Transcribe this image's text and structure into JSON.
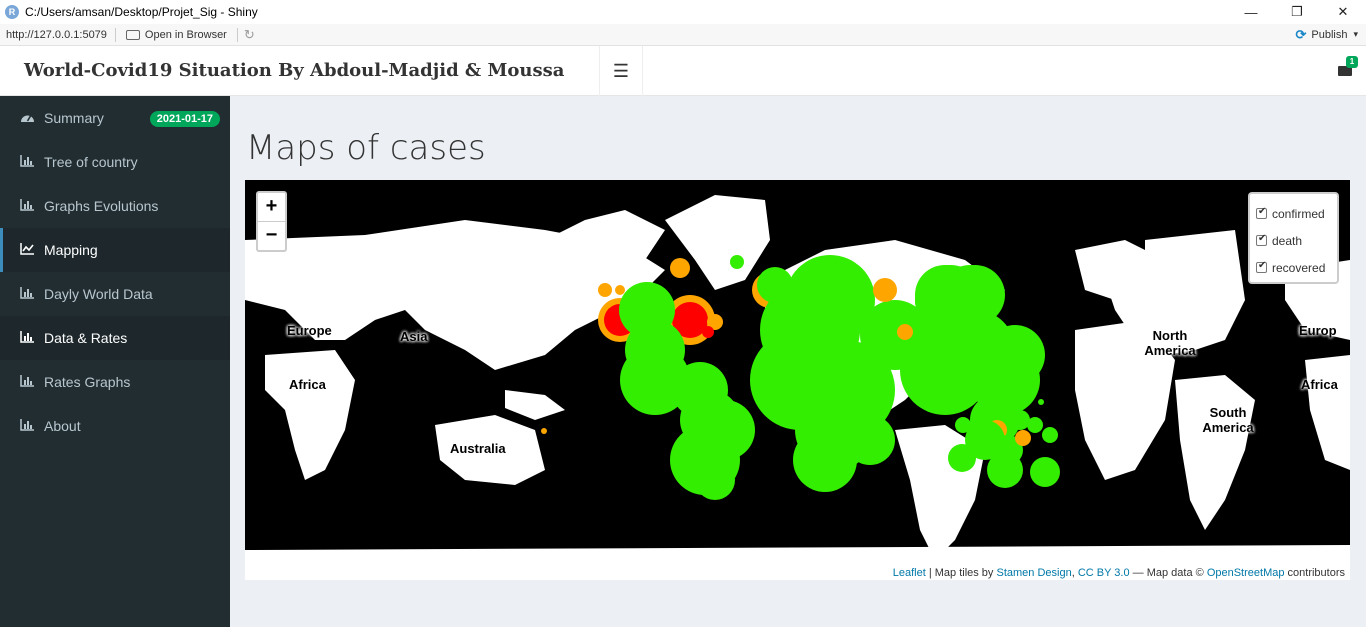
{
  "window": {
    "title": "C:/Users/amsan/Desktop/Projet_Sig - Shiny",
    "app_icon": "R",
    "minimize": "—",
    "maximize": "❐",
    "close": "✕"
  },
  "toolbar": {
    "url": "http://127.0.0.1:5079",
    "open_browser": "Open in Browser",
    "publish": "Publish",
    "publish_caret": "▾"
  },
  "header": {
    "brand": "World-Covid19 Situation By Abdoul-Madjid & Moussa",
    "menu_icon": "☰",
    "notifications_count": "1"
  },
  "sidebar": {
    "items": [
      {
        "label": "Summary",
        "icon": "dashboard-icon",
        "badge": "2021-01-17"
      },
      {
        "label": "Tree of country",
        "icon": "bar-chart-icon"
      },
      {
        "label": "Graphs Evolutions",
        "icon": "bar-chart-icon"
      },
      {
        "label": "Mapping",
        "icon": "line-chart-icon",
        "active": true
      },
      {
        "label": "Dayly World Data",
        "icon": "bar-chart-icon"
      },
      {
        "label": "Data & Rates",
        "icon": "bar-chart-icon"
      },
      {
        "label": "Rates Graphs",
        "icon": "bar-chart-icon"
      },
      {
        "label": "About",
        "icon": "bar-chart-icon"
      }
    ]
  },
  "main": {
    "title": "Maps of cases",
    "map": {
      "zoom_in": "+",
      "zoom_out": "−",
      "layers": [
        {
          "label": "confirmed",
          "checked": true
        },
        {
          "label": "death",
          "checked": true
        },
        {
          "label": "recovered",
          "checked": true
        }
      ],
      "labels": {
        "europe_left": "Europe",
        "asia": "Asia",
        "africa_left": "Africa",
        "australia": "Australia",
        "north_america": "North America",
        "europe_right": "Europ",
        "africa_right": "Africa",
        "south_america": "South America"
      },
      "attribution": {
        "leaflet": "Leaflet",
        "tiles_text": " | Map tiles by ",
        "stamen": "Stamen Design",
        "sep": ", ",
        "cc": "CC BY 3.0",
        "data_text": " — Map data © ",
        "osm": "OpenStreetMap",
        "contrib": " contributors"
      },
      "colors": {
        "confirmed": "#ffa500",
        "death": "#ff0000",
        "recovered": "#33ee00",
        "ocean": "#000000",
        "land": "#ffffff"
      }
    }
  }
}
